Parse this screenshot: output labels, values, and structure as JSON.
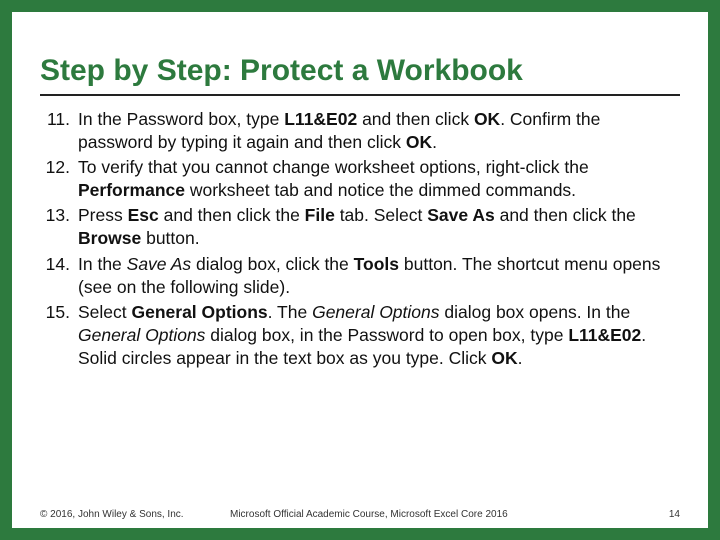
{
  "title": "Step by Step: Protect a Workbook",
  "items": [
    {
      "num": "11."
    },
    {
      "num": "12."
    },
    {
      "num": "13."
    },
    {
      "num": "14."
    },
    {
      "num": "15."
    }
  ],
  "t": {
    "s11a": "In the Password box, type ",
    "s11b": "L11&E02",
    "s11c": " and then click ",
    "s11d": "OK",
    "s11e": ". Confirm the password by typing it again and then click ",
    "s11f": "OK",
    "s11g": ".",
    "s12a": "To verify that you cannot change worksheet options, right-click the ",
    "s12b": "Performance",
    "s12c": " worksheet tab and notice the dimmed commands.",
    "s13a": "Press ",
    "s13b": "Esc",
    "s13c": " and then click the ",
    "s13d": "File",
    "s13e": " tab. Select ",
    "s13f": "Save As",
    "s13g": " and then click the ",
    "s13h": "Browse",
    "s13i": " button.",
    "s14a": "In the ",
    "s14b": "Save As",
    "s14c": " dialog box, click the ",
    "s14d": "Tools",
    "s14e": " button. The shortcut menu opens (see on the following slide).",
    "s15a": "Select ",
    "s15b": "General Options",
    "s15c": ". The ",
    "s15d": "General Options",
    "s15e": " dialog box opens. In the ",
    "s15f": "General Options",
    "s15g": " dialog box, in the Password to open box, type ",
    "s15h": "L11&E02",
    "s15i": ". Solid circles appear in the text box as you type. Click ",
    "s15j": "OK",
    "s15k": "."
  },
  "footer": {
    "left": "© 2016, John Wiley & Sons, Inc.",
    "center": "Microsoft Official Academic Course, Microsoft Excel Core 2016",
    "right": "14"
  }
}
